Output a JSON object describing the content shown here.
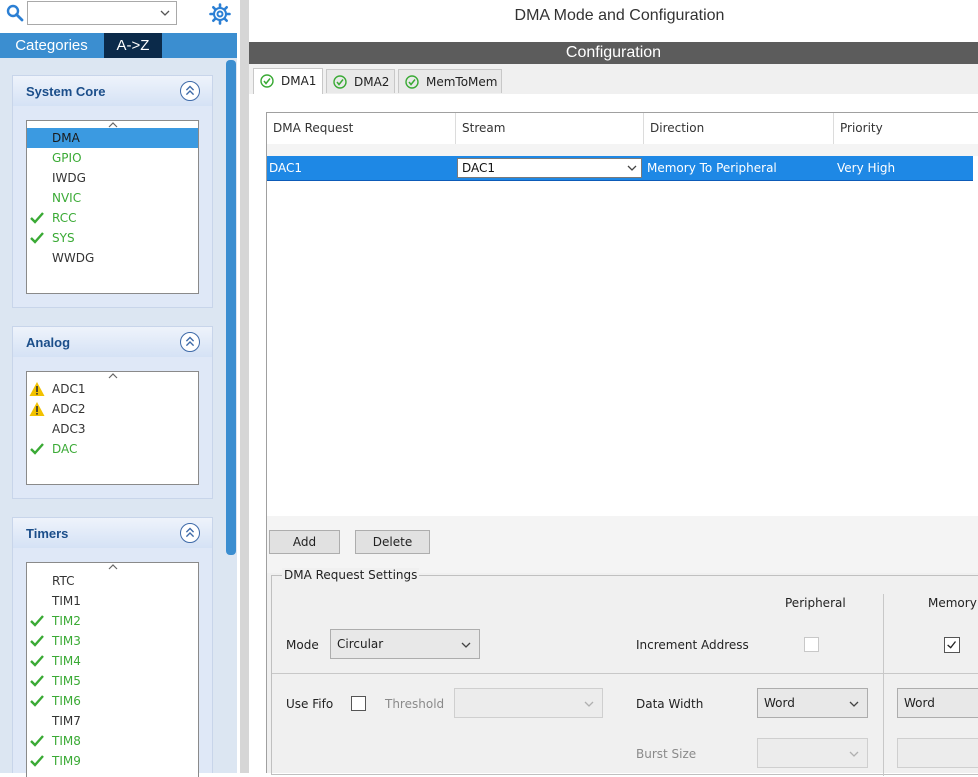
{
  "left": {
    "search": {
      "value": ""
    },
    "tabs": [
      {
        "label": "Categories"
      },
      {
        "label": "A->Z"
      }
    ],
    "groups": [
      {
        "title": "System Core",
        "items": [
          {
            "label": "DMA",
            "status": "selected"
          },
          {
            "label": "GPIO",
            "status": "green"
          },
          {
            "label": "IWDG",
            "status": "none"
          },
          {
            "label": "NVIC",
            "status": "green"
          },
          {
            "label": "RCC",
            "status": "check"
          },
          {
            "label": "SYS",
            "status": "check"
          },
          {
            "label": "WWDG",
            "status": "none"
          }
        ]
      },
      {
        "title": "Analog",
        "items": [
          {
            "label": "ADC1",
            "status": "warning"
          },
          {
            "label": "ADC2",
            "status": "warning"
          },
          {
            "label": "ADC3",
            "status": "none"
          },
          {
            "label": "DAC",
            "status": "check"
          }
        ]
      },
      {
        "title": "Timers",
        "items": [
          {
            "label": "RTC",
            "status": "none"
          },
          {
            "label": "TIM1",
            "status": "none"
          },
          {
            "label": "TIM2",
            "status": "check"
          },
          {
            "label": "TIM3",
            "status": "check"
          },
          {
            "label": "TIM4",
            "status": "check"
          },
          {
            "label": "TIM5",
            "status": "check"
          },
          {
            "label": "TIM6",
            "status": "check"
          },
          {
            "label": "TIM7",
            "status": "none"
          },
          {
            "label": "TIM8",
            "status": "check"
          },
          {
            "label": "TIM9",
            "status": "check"
          }
        ]
      }
    ]
  },
  "right": {
    "title": "DMA Mode and Configuration",
    "config_bar": "Configuration",
    "tabs": [
      {
        "label": "DMA1"
      },
      {
        "label": "DMA2"
      },
      {
        "label": "MemToMem"
      }
    ],
    "table": {
      "columns": [
        "DMA Request",
        "Stream",
        "Direction",
        "Priority"
      ],
      "rows": [
        {
          "request": "DAC1",
          "stream": "DAC1",
          "direction": "Memory To Peripheral",
          "priority": "Very High"
        }
      ]
    },
    "buttons": {
      "add": "Add",
      "delete": "Delete"
    },
    "settings": {
      "legend": "DMA Request Settings",
      "peripheral_header": "Peripheral",
      "memory_header": "Memory",
      "mode_label": "Mode",
      "mode_value": "Circular",
      "increment_label": "Increment Address",
      "peripheral_increment": false,
      "memory_increment": true,
      "use_fifo_label": "Use Fifo",
      "threshold_label": "Threshold",
      "threshold_value": "",
      "data_width_label": "Data Width",
      "peripheral_width": "Word",
      "memory_width": "Word",
      "burst_label": "Burst Size",
      "peripheral_burst": "",
      "memory_burst": ""
    }
  },
  "colors": {
    "accent": "#3b8ed0",
    "selected_row": "#1e88e5",
    "ok_green": "#3aaa35",
    "warning": "#f2c200"
  }
}
